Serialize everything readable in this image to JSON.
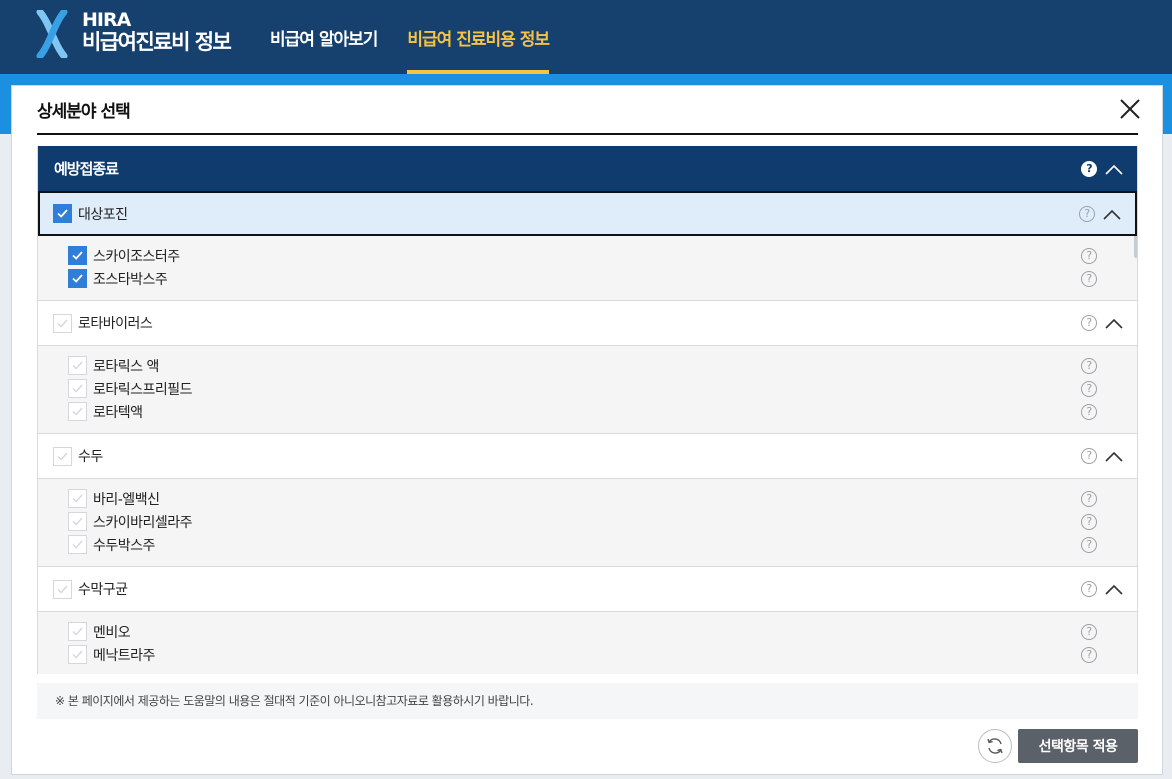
{
  "header": {
    "logo_en": "HIRA",
    "logo_ko": "비급여진료비 정보",
    "nav": [
      {
        "label": "비급여 알아보기",
        "active": false
      },
      {
        "label": "비급여 진료비용 정보",
        "active": true
      }
    ]
  },
  "modal": {
    "title": "상세분야 선택",
    "group": "예방접종료",
    "categories": [
      {
        "label": "대상포진",
        "checked": true,
        "selected": true,
        "items": [
          {
            "label": "스카이조스터주",
            "checked": true
          },
          {
            "label": "조스타박스주",
            "checked": true
          }
        ]
      },
      {
        "label": "로타바이러스",
        "checked": false,
        "selected": false,
        "items": [
          {
            "label": "로타릭스 액",
            "checked": false
          },
          {
            "label": "로타릭스프리필드",
            "checked": false
          },
          {
            "label": "로타텍액",
            "checked": false
          }
        ]
      },
      {
        "label": "수두",
        "checked": false,
        "selected": false,
        "items": [
          {
            "label": "바리-엘백신",
            "checked": false
          },
          {
            "label": "스카이바리셀라주",
            "checked": false
          },
          {
            "label": "수두박스주",
            "checked": false
          }
        ]
      },
      {
        "label": "수막구균",
        "checked": false,
        "selected": false,
        "items": [
          {
            "label": "멘비오",
            "checked": false
          },
          {
            "label": "메낙트라주",
            "checked": false
          }
        ]
      }
    ],
    "notice": "※ 본 페이지에서 제공하는 도움말의 내용은 절대적 기준이 아니오니참고자료로 활용하시기 바랍니다.",
    "apply_label": "선택항목 적용",
    "help_glyph": "?"
  },
  "colors": {
    "header": "#16406e",
    "accent": "#f6c344",
    "group_head": "#0f3b6e",
    "checkbox": "#2f7ed8",
    "apply": "#5b6169"
  }
}
